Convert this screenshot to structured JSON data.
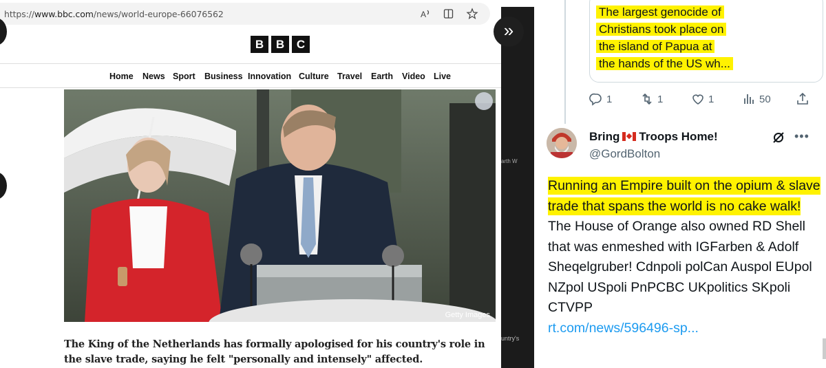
{
  "browser": {
    "url_prefix": "https://",
    "url_domain": "www.bbc.com",
    "url_path": "/news/world-europe-66076562",
    "icons": [
      "read-aloud-icon",
      "reading-view-icon",
      "favorite-star-icon"
    ]
  },
  "bbc": {
    "logo_letters": [
      "B",
      "B",
      "C"
    ],
    "nav": [
      "Home",
      "News",
      "Sport",
      "Business",
      "Innovation",
      "Culture",
      "Travel",
      "Earth",
      "Video",
      "Live"
    ],
    "photo_credit": "Getty Images",
    "caption": "The King of the Netherlands has formally apologised for his country's role in the slave trade, saying he felt \"personally and intensely\" affected."
  },
  "twitter": {
    "quote_lines": [
      "The largest genocide of",
      "Christians took place on",
      "the island of Papua at",
      "the hands of the US wh..."
    ],
    "actions": {
      "replies": "1",
      "retweets": "1",
      "likes": "1",
      "views": "50"
    },
    "tweet": {
      "display_name_before_flag": "Bring",
      "display_name_after_flag": "Troops Home!",
      "handle": "@GordBolton",
      "highlighted_text": "Running an Empire built on the opium & slave trade that spans the world is no cake walk!",
      "body_text": " The House of Orange also owned RD Shell that was enmeshed with IGFarben & Adolf Sheqelgruber! Cdnpoli polCan Auspol EUpol NZpol USpoli PnPCBC UKpolitics SKpoli CTVPP",
      "link": "rt.com/news/596496-sp..."
    }
  },
  "middle": {
    "fragment_1": "arth  W",
    "fragment_2": "untry's"
  },
  "colors": {
    "highlight": "#fff200",
    "link": "#1d9bf0",
    "bbc_red": "#d4242b"
  }
}
